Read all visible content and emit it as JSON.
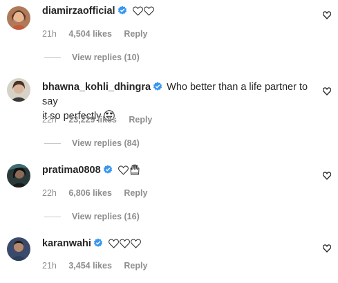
{
  "comments": [
    {
      "username": "diamirzaofficial",
      "text": "",
      "emojis": [
        "heart",
        "heart"
      ],
      "time": "21h",
      "likes": "4,504 likes",
      "reply": "Reply",
      "view_replies": "View replies (10)"
    },
    {
      "username": "bhawna_kohli_dhingra",
      "text_line1": "Who better than a life partner to say",
      "text_line2": "it so perfectly",
      "emojis": [
        "heart-eyes-face"
      ],
      "time": "22h",
      "likes": "23,229 likes",
      "reply": "Reply",
      "view_replies": "View replies (84)"
    },
    {
      "username": "pratima0808",
      "text": "",
      "emojis": [
        "heart",
        "raised-hands"
      ],
      "time": "22h",
      "likes": "6,806 likes",
      "reply": "Reply",
      "view_replies": "View replies (16)"
    },
    {
      "username": "karanwahi",
      "text": "",
      "emojis": [
        "heart",
        "heart",
        "heart"
      ],
      "time": "21h",
      "likes": "3,454 likes",
      "reply": "Reply"
    }
  ],
  "colors": {
    "verified_blue": "#3897f0",
    "text_primary": "#262626",
    "text_secondary": "#8e8e8e"
  }
}
